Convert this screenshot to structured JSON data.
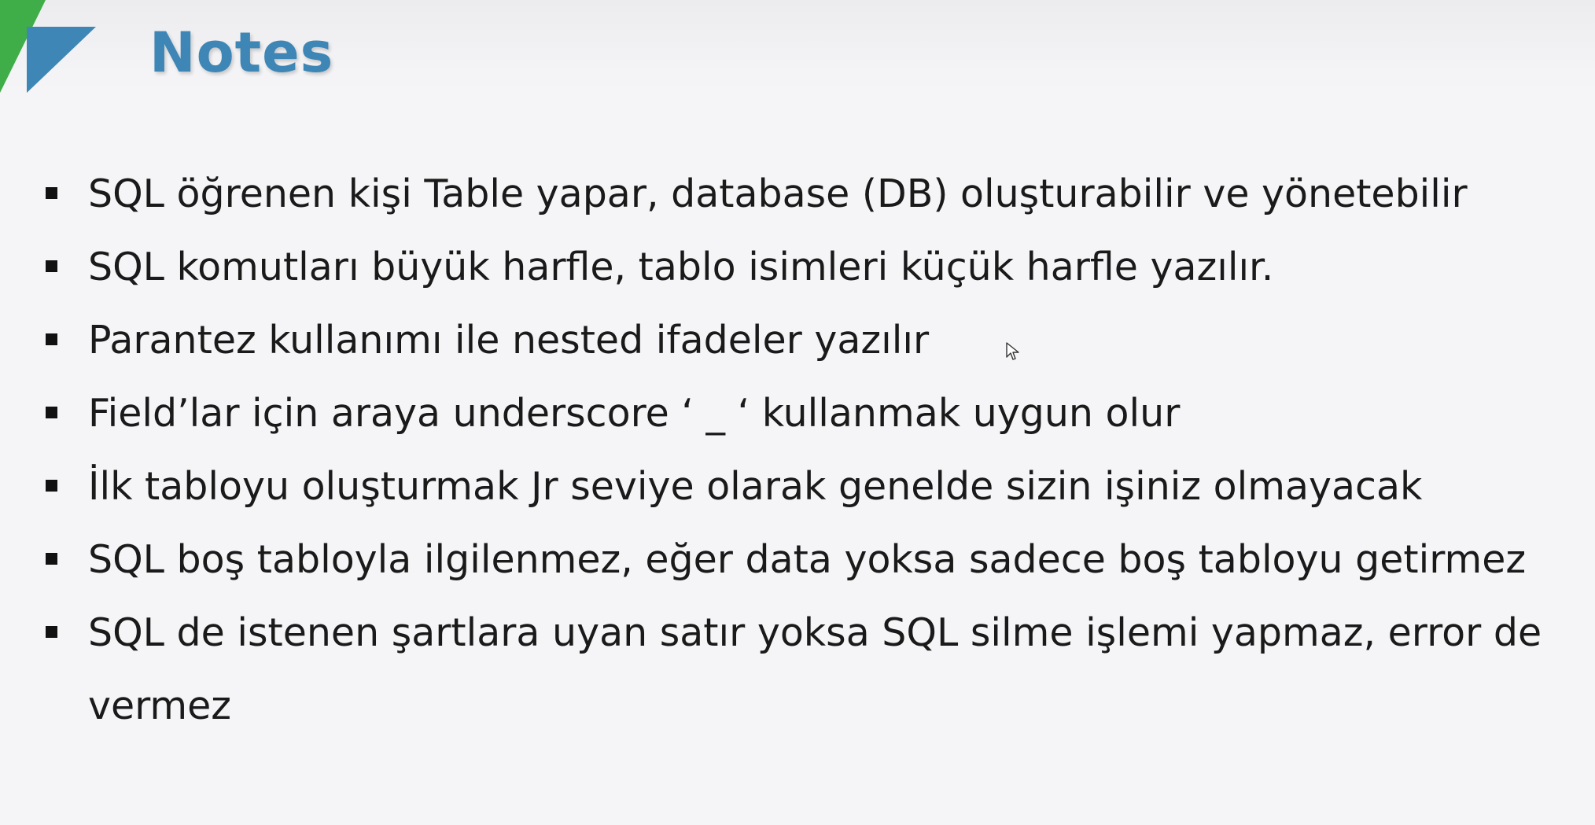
{
  "slide": {
    "title": "Notes",
    "colors": {
      "title": "#3d86b5",
      "logo_green": "#3fae49",
      "logo_blue": "#3d86b5",
      "text": "#1a1a1a",
      "background": "#f5f5f7"
    },
    "notes": [
      "SQL öğrenen kişi Table yapar, database (DB) oluşturabilir ve yönetebilir",
      "SQL komutları büyük harfle, tablo isimleri küçük harfle yazılır.",
      "Parantez kullanımı ile nested ifadeler yazılır",
      "Field’lar için araya underscore  ‘ _ ‘ kullanmak uygun olur",
      "İlk tabloyu oluşturmak Jr seviye olarak genelde sizin işiniz olmayacak",
      "SQL boş tabloyla ilgilenmez, eğer data yoksa sadece boş tabloyu getirmez",
      "SQL de istenen şartlara uyan satır yoksa SQL silme işlemi yapmaz, error de vermez"
    ]
  }
}
